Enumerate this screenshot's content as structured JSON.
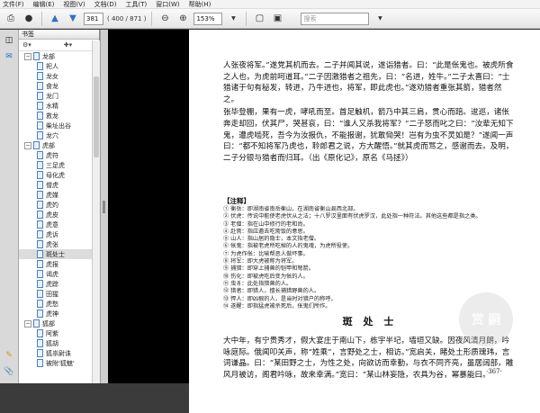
{
  "menu": [
    "文件(F)",
    "编辑(E)",
    "视图(V)",
    "文档(D)",
    "工具(T)",
    "窗口(W)",
    "帮助(H)"
  ],
  "toolbar": {
    "page_current": "381",
    "page_total": "( 400 / 871 )",
    "zoom": "153%",
    "search_placeholder": "搜索"
  },
  "bookmarks": {
    "panel_title": "书签",
    "nodes": [
      {
        "label": "龙部",
        "level": 1,
        "type": "folder",
        "expanded": true
      },
      {
        "label": "祀人",
        "level": 2,
        "type": "page"
      },
      {
        "label": "龙女",
        "level": 2,
        "type": "page"
      },
      {
        "label": "食龙",
        "level": 2,
        "type": "page"
      },
      {
        "label": "龙门",
        "level": 2,
        "type": "page"
      },
      {
        "label": "水精",
        "level": 2,
        "type": "page"
      },
      {
        "label": "救龙",
        "level": 2,
        "type": "page"
      },
      {
        "label": "柴址出谷",
        "level": 2,
        "type": "page"
      },
      {
        "label": "龙穴",
        "level": 2,
        "type": "page"
      },
      {
        "label": "虎部",
        "level": 1,
        "type": "folder",
        "expanded": true
      },
      {
        "label": "虎符",
        "level": 2,
        "type": "page"
      },
      {
        "label": "三足虎",
        "level": 2,
        "type": "page"
      },
      {
        "label": "母化虎",
        "level": 2,
        "type": "page"
      },
      {
        "label": "僧虎",
        "level": 2,
        "type": "page"
      },
      {
        "label": "虎媒",
        "level": 2,
        "type": "page"
      },
      {
        "label": "虎妁",
        "level": 2,
        "type": "page"
      },
      {
        "label": "虎皮",
        "level": 2,
        "type": "page"
      },
      {
        "label": "虎意",
        "level": 2,
        "type": "page"
      },
      {
        "label": "虎诉",
        "level": 2,
        "type": "page"
      },
      {
        "label": "虎张",
        "level": 2,
        "type": "page"
      },
      {
        "label": "斑处士",
        "level": 2,
        "type": "page",
        "selected": true
      },
      {
        "label": "虎报",
        "level": 2,
        "type": "page"
      },
      {
        "label": "谒虎",
        "level": 2,
        "type": "page"
      },
      {
        "label": "虎踪",
        "level": 2,
        "type": "page"
      },
      {
        "label": "田猩",
        "level": 2,
        "type": "page"
      },
      {
        "label": "虎愁",
        "level": 2,
        "type": "page"
      },
      {
        "label": "虎神",
        "level": 2,
        "type": "page"
      },
      {
        "label": "狐部",
        "level": 1,
        "type": "folder",
        "expanded": true
      },
      {
        "label": "阿紫",
        "level": 2,
        "type": "page"
      },
      {
        "label": "狐胡",
        "level": 2,
        "type": "page"
      },
      {
        "label": "狐祟尉诛",
        "level": 2,
        "type": "page"
      },
      {
        "label": "被附'狐魅'",
        "level": 2,
        "type": "page"
      }
    ]
  },
  "document": {
    "paras_top": [
      "人张夜将军。”遂党其机而去。二子并闻其说，遂诣猎者。曰：“此是伥鬼也。被虎所食之人也，为虎前呵道耳。”二子因激猎者之祖先，曰：“名进，姓牛。”二子太喜曰：“士猎诸于句有秘发，转进，乃牛进也，将军，即此虎也。”遂劝猎者重张其箭，猎者然之。",
      "张毕登棚，果有一虎，哮吼而至。首足触机，箭乃中其三肩，贯心而踣。逡巡，诸伥奔走却回，伏其尸，哭甚哀，曰：“谁人又杀我将军？”二子怒而叱之曰：“汝辈无知下鬼，遭虎啮死，吾今为汝报仇，不能报谢，犹敢恸哭！岂有为虫不灵如是？”遂闻一声曰：“都不知将军乃虎也，聆郎君之说，方大醒悟。”就其虎而骂之，感谢而去。及明，二子分银与猎者而归耳。（出《原化记》，原名《马拯》）"
    ],
    "notes_title": "【注释】",
    "notes": [
      "① 衡岳：即湖南省南岳衡山，在湖南省衡山县西北部。",
      "② 伏虎：传说中能使老虎伏从之法；十八罗汉里面有伏虎罗汉，此处指一种符法。其他这些都是指之类。",
      "③ 老僧：指在山中修行的老和尚。",
      "④ 赴斋：指应邀去吃斋饭的意思。",
      "⑤ 山人：指山居的隐士，本文指老僧。",
      "⑥ 伥鬼：指被老虎所吃掉的人的鬼魂，为虎所役使。",
      "⑦ 为虎作伥：比喻帮恶人做坏事。",
      "⑧ 将军：即大虎被称为将军。",
      "⑨ 捕猎：即穿上捕兽的铠甲和弩箭。",
      "⑩ 伤化：即被虎吃后变为伥的人。",
      "⑪ 虫豸：此处指猎兽的人。",
      "⑫ 猎者：即猎人，擅长捕猎野兽的人。",
      "⑬ 悍人：即凶狠的人，是当时对猎户的称呼。",
      "⑭ 遂醒：即指猛虎被杀死后，伥鬼们所作。"
    ],
    "section_title": "斑 处 士",
    "paras_bottom": [
      "大中年，有宁贵秀才，假大宴庄于南山下，栋宇半圮，墙垣又缺。因夜风清月朗，吟咏庭际。俄闻叩关声，称“姓乘”，言野处之士，相访。”宽启关，睹处土形质瑰玮，言词谦晶。曰：“某田野之士，为性之处，向欲访而幸勤，与衣不同齐亮，虽居阔部，雕风月被访，阁君吟咏，故来幸满。”宽曰：“某山林妄隐，农具为谷，幂暴能曰。"
    ],
    "page_number": "·367·",
    "watermark": "赏 嗣"
  }
}
